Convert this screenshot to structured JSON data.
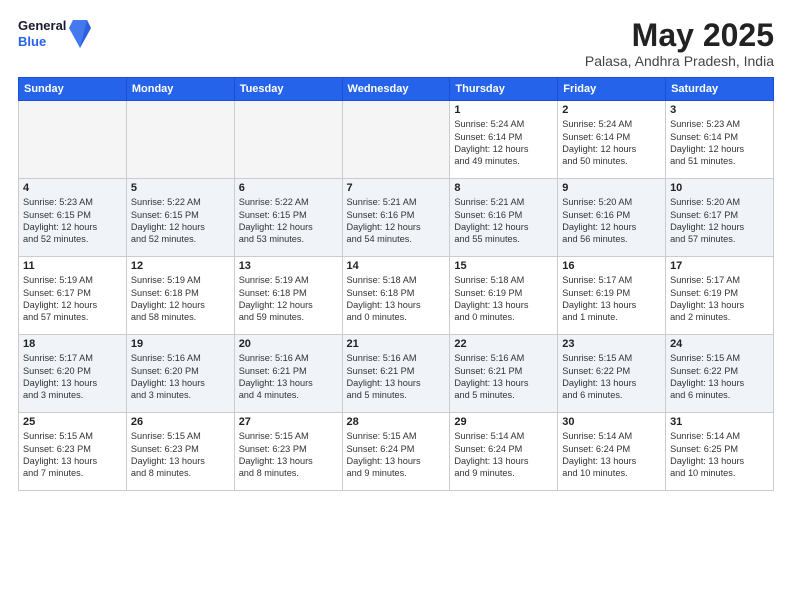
{
  "header": {
    "logo_general": "General",
    "logo_blue": "Blue",
    "month_title": "May 2025",
    "location": "Palasa, Andhra Pradesh, India"
  },
  "weekdays": [
    "Sunday",
    "Monday",
    "Tuesday",
    "Wednesday",
    "Thursday",
    "Friday",
    "Saturday"
  ],
  "weeks": [
    [
      {
        "day": "",
        "info": ""
      },
      {
        "day": "",
        "info": ""
      },
      {
        "day": "",
        "info": ""
      },
      {
        "day": "",
        "info": ""
      },
      {
        "day": "1",
        "info": "Sunrise: 5:24 AM\nSunset: 6:14 PM\nDaylight: 12 hours\nand 49 minutes."
      },
      {
        "day": "2",
        "info": "Sunrise: 5:24 AM\nSunset: 6:14 PM\nDaylight: 12 hours\nand 50 minutes."
      },
      {
        "day": "3",
        "info": "Sunrise: 5:23 AM\nSunset: 6:14 PM\nDaylight: 12 hours\nand 51 minutes."
      }
    ],
    [
      {
        "day": "4",
        "info": "Sunrise: 5:23 AM\nSunset: 6:15 PM\nDaylight: 12 hours\nand 52 minutes."
      },
      {
        "day": "5",
        "info": "Sunrise: 5:22 AM\nSunset: 6:15 PM\nDaylight: 12 hours\nand 52 minutes."
      },
      {
        "day": "6",
        "info": "Sunrise: 5:22 AM\nSunset: 6:15 PM\nDaylight: 12 hours\nand 53 minutes."
      },
      {
        "day": "7",
        "info": "Sunrise: 5:21 AM\nSunset: 6:16 PM\nDaylight: 12 hours\nand 54 minutes."
      },
      {
        "day": "8",
        "info": "Sunrise: 5:21 AM\nSunset: 6:16 PM\nDaylight: 12 hours\nand 55 minutes."
      },
      {
        "day": "9",
        "info": "Sunrise: 5:20 AM\nSunset: 6:16 PM\nDaylight: 12 hours\nand 56 minutes."
      },
      {
        "day": "10",
        "info": "Sunrise: 5:20 AM\nSunset: 6:17 PM\nDaylight: 12 hours\nand 57 minutes."
      }
    ],
    [
      {
        "day": "11",
        "info": "Sunrise: 5:19 AM\nSunset: 6:17 PM\nDaylight: 12 hours\nand 57 minutes."
      },
      {
        "day": "12",
        "info": "Sunrise: 5:19 AM\nSunset: 6:18 PM\nDaylight: 12 hours\nand 58 minutes."
      },
      {
        "day": "13",
        "info": "Sunrise: 5:19 AM\nSunset: 6:18 PM\nDaylight: 12 hours\nand 59 minutes."
      },
      {
        "day": "14",
        "info": "Sunrise: 5:18 AM\nSunset: 6:18 PM\nDaylight: 13 hours\nand 0 minutes."
      },
      {
        "day": "15",
        "info": "Sunrise: 5:18 AM\nSunset: 6:19 PM\nDaylight: 13 hours\nand 0 minutes."
      },
      {
        "day": "16",
        "info": "Sunrise: 5:17 AM\nSunset: 6:19 PM\nDaylight: 13 hours\nand 1 minute."
      },
      {
        "day": "17",
        "info": "Sunrise: 5:17 AM\nSunset: 6:19 PM\nDaylight: 13 hours\nand 2 minutes."
      }
    ],
    [
      {
        "day": "18",
        "info": "Sunrise: 5:17 AM\nSunset: 6:20 PM\nDaylight: 13 hours\nand 3 minutes."
      },
      {
        "day": "19",
        "info": "Sunrise: 5:16 AM\nSunset: 6:20 PM\nDaylight: 13 hours\nand 3 minutes."
      },
      {
        "day": "20",
        "info": "Sunrise: 5:16 AM\nSunset: 6:21 PM\nDaylight: 13 hours\nand 4 minutes."
      },
      {
        "day": "21",
        "info": "Sunrise: 5:16 AM\nSunset: 6:21 PM\nDaylight: 13 hours\nand 5 minutes."
      },
      {
        "day": "22",
        "info": "Sunrise: 5:16 AM\nSunset: 6:21 PM\nDaylight: 13 hours\nand 5 minutes."
      },
      {
        "day": "23",
        "info": "Sunrise: 5:15 AM\nSunset: 6:22 PM\nDaylight: 13 hours\nand 6 minutes."
      },
      {
        "day": "24",
        "info": "Sunrise: 5:15 AM\nSunset: 6:22 PM\nDaylight: 13 hours\nand 6 minutes."
      }
    ],
    [
      {
        "day": "25",
        "info": "Sunrise: 5:15 AM\nSunset: 6:23 PM\nDaylight: 13 hours\nand 7 minutes."
      },
      {
        "day": "26",
        "info": "Sunrise: 5:15 AM\nSunset: 6:23 PM\nDaylight: 13 hours\nand 8 minutes."
      },
      {
        "day": "27",
        "info": "Sunrise: 5:15 AM\nSunset: 6:23 PM\nDaylight: 13 hours\nand 8 minutes."
      },
      {
        "day": "28",
        "info": "Sunrise: 5:15 AM\nSunset: 6:24 PM\nDaylight: 13 hours\nand 9 minutes."
      },
      {
        "day": "29",
        "info": "Sunrise: 5:14 AM\nSunset: 6:24 PM\nDaylight: 13 hours\nand 9 minutes."
      },
      {
        "day": "30",
        "info": "Sunrise: 5:14 AM\nSunset: 6:24 PM\nDaylight: 13 hours\nand 10 minutes."
      },
      {
        "day": "31",
        "info": "Sunrise: 5:14 AM\nSunset: 6:25 PM\nDaylight: 13 hours\nand 10 minutes."
      }
    ]
  ]
}
